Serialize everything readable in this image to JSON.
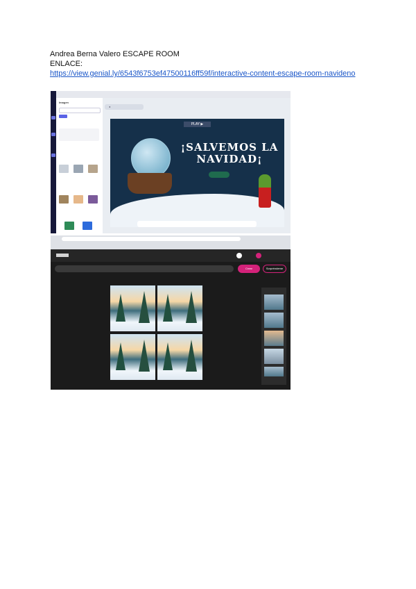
{
  "document": {
    "title": "Andrea Berna Valero ESCAPE ROOM",
    "label": "ENLACE:",
    "link": "https://view.genial.ly/6543f6753ef47500116ff59f/interactive-content-escape-room-navideno"
  },
  "screenshot_editor": {
    "panel_heading": "Imagen",
    "slide": {
      "play_label": "PLAY ▶",
      "title": "¡SALVEMOS LA NAVIDAD¡"
    }
  },
  "screenshot_creator": {
    "create_button": "Crear",
    "ideas_button": "Sorpréndeme"
  },
  "colors": {
    "link": "#1a56c8",
    "slide_bg": "#15304a",
    "accent_pink": "#d4227a"
  }
}
